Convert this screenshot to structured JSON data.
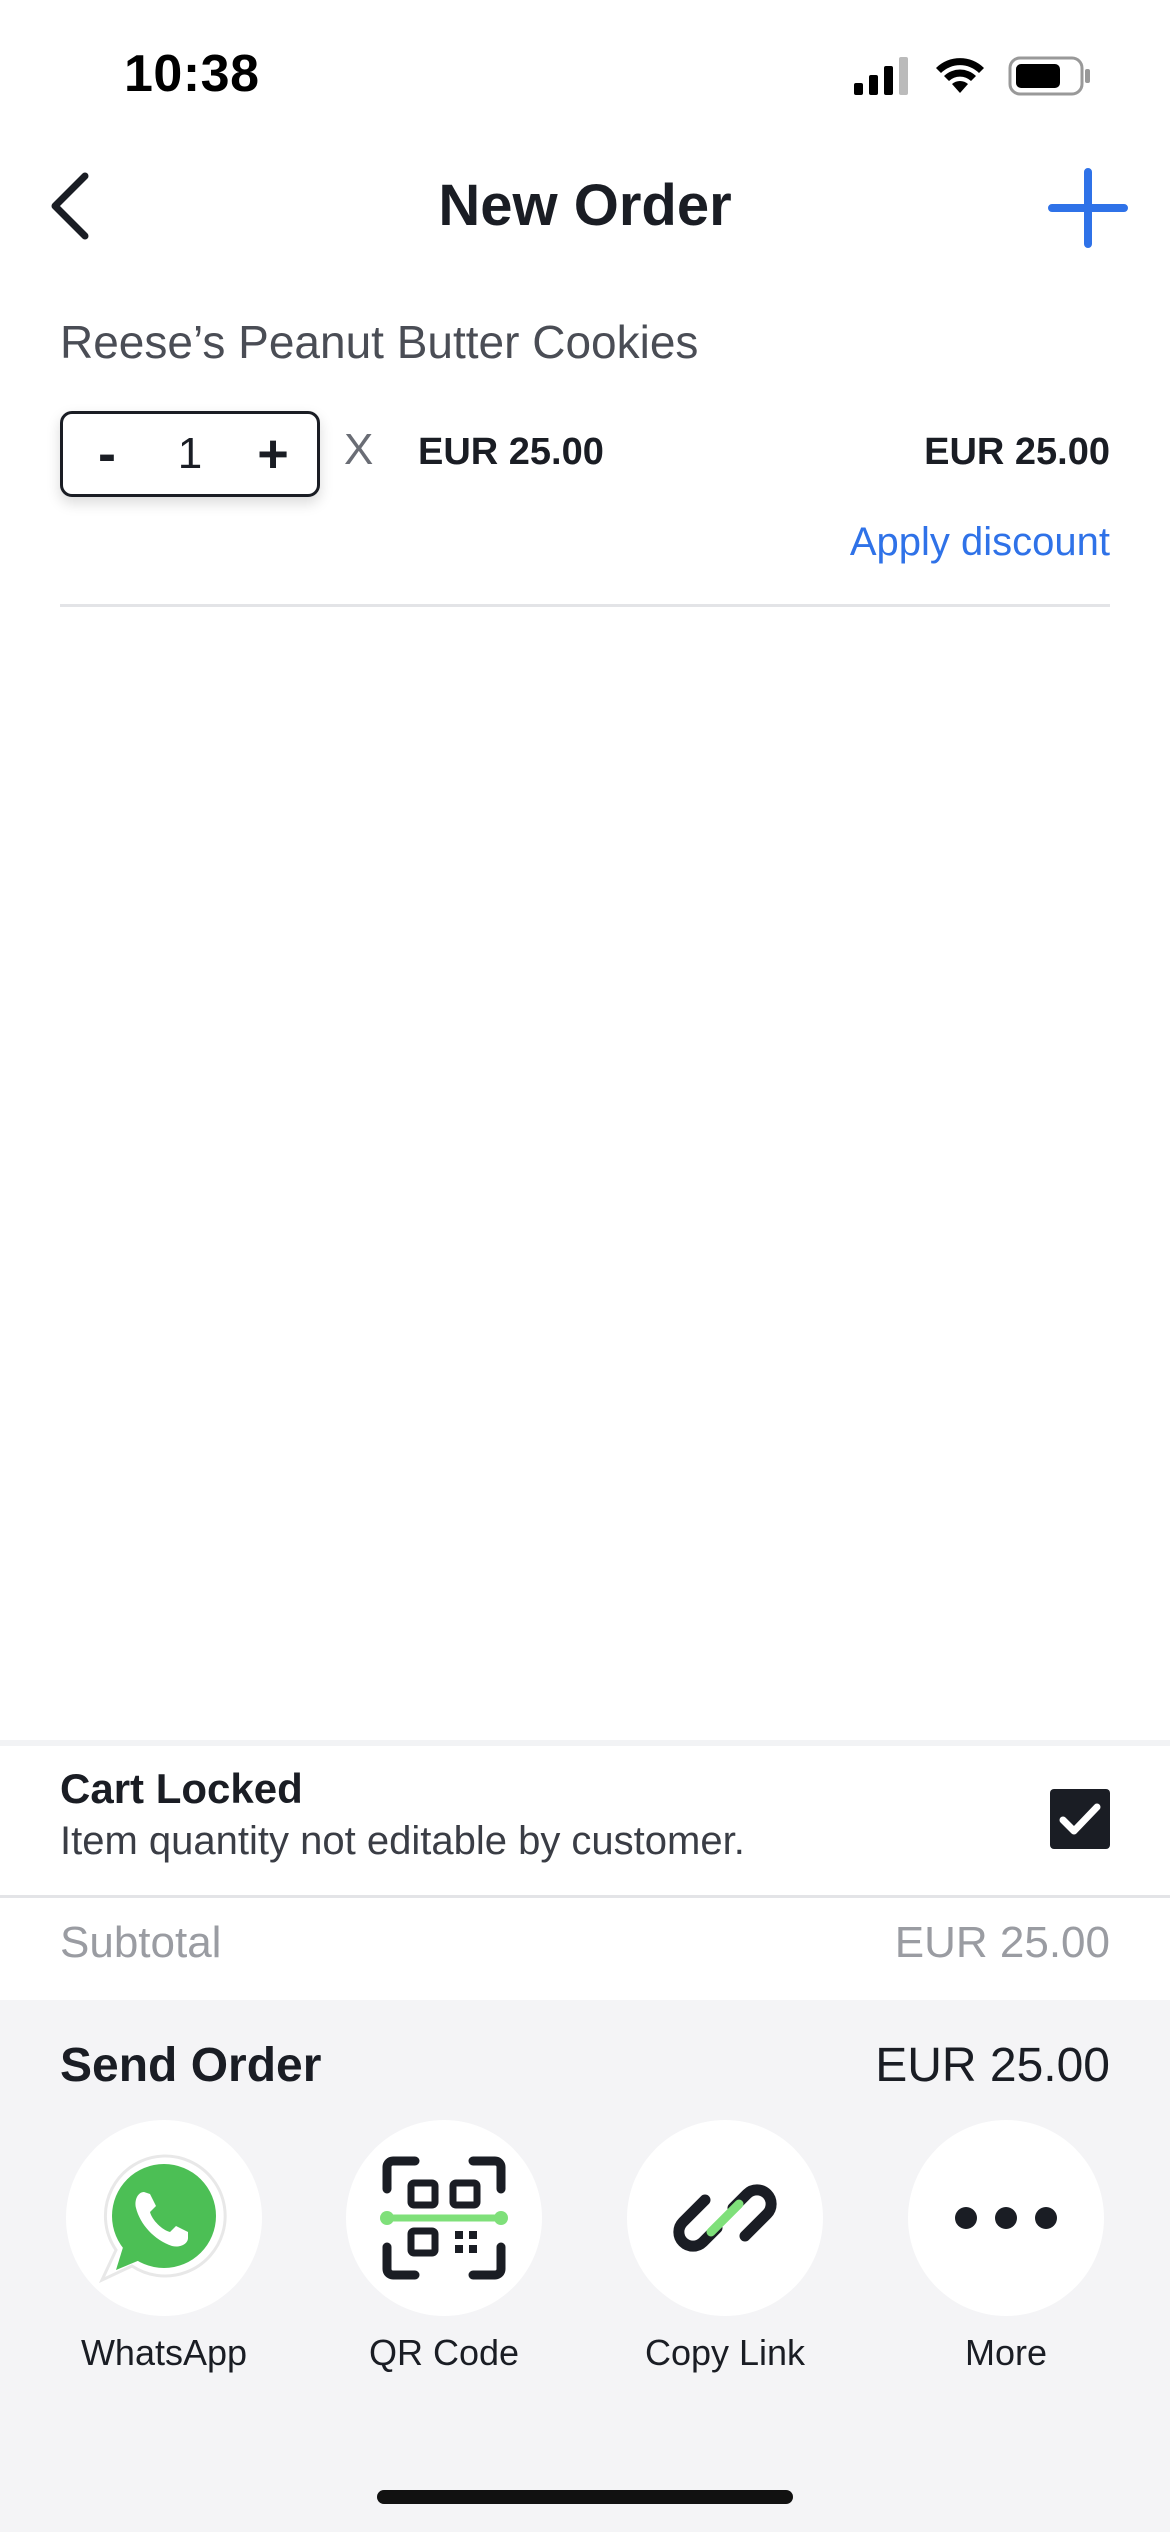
{
  "status_bar": {
    "time": "10:38"
  },
  "nav": {
    "title": "New Order"
  },
  "item": {
    "name": "Reese’s Peanut Butter Cookies",
    "decrement_label": "-",
    "increment_label": "+",
    "quantity": "1",
    "times_symbol": "X",
    "unit_price": "EUR 25.00",
    "line_total": "EUR 25.00",
    "apply_discount_label": "Apply discount"
  },
  "cart_locked": {
    "title": "Cart Locked",
    "subtitle": "Item quantity not editable by customer.",
    "checked": true
  },
  "subtotal": {
    "label": "Subtotal",
    "value": "EUR 25.00"
  },
  "send_order": {
    "title": "Send Order",
    "total": "EUR 25.00",
    "options": [
      {
        "label": "WhatsApp",
        "icon": "whatsapp-icon"
      },
      {
        "label": "QR Code",
        "icon": "qr-code-icon"
      },
      {
        "label": "Copy Link",
        "icon": "link-icon"
      },
      {
        "label": "More",
        "icon": "more-dots-icon"
      }
    ]
  },
  "colors": {
    "accent_blue": "#2f72e8",
    "whatsapp_green": "#4cbf55",
    "qr_accent_green": "#7fe07a",
    "text_dark": "#1a1d24",
    "muted_gray": "#9a9ca2",
    "panel_bg": "#f4f4f6"
  }
}
